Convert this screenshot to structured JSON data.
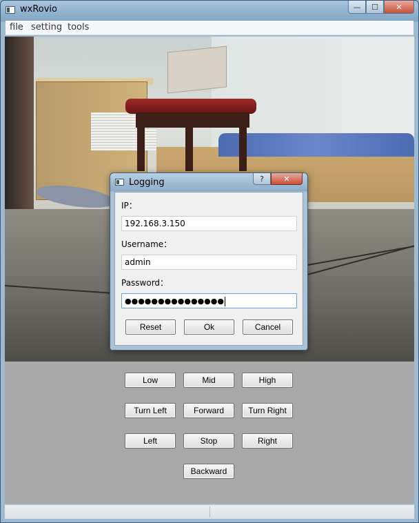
{
  "window": {
    "title": "wxRovio",
    "minimize_glyph": "—",
    "maximize_glyph": "☐",
    "close_glyph": "✕"
  },
  "menubar": {
    "items": [
      "file",
      "setting",
      "tools"
    ]
  },
  "camera": {
    "description_icon": "camera-feed"
  },
  "controls": {
    "speed": [
      "Low",
      "Mid",
      "High"
    ],
    "row2": [
      "Turn Left",
      "Forward",
      "Turn Right"
    ],
    "row3": [
      "Left",
      "Stop",
      "Right"
    ],
    "backward": "Backward"
  },
  "statusbar": {
    "left": "",
    "right": ""
  },
  "dialog": {
    "title": "Logging",
    "help_glyph": "?",
    "close_glyph": "✕",
    "ip_label": "IP：",
    "ip_value": "192.168.3.150",
    "username_label": "Username：",
    "username_value": "admin",
    "password_label": "Password：",
    "password_masked": "●●●●●●●●●●●●●●●",
    "buttons": {
      "reset": "Reset",
      "ok": "Ok",
      "cancel": "Cancel"
    }
  }
}
